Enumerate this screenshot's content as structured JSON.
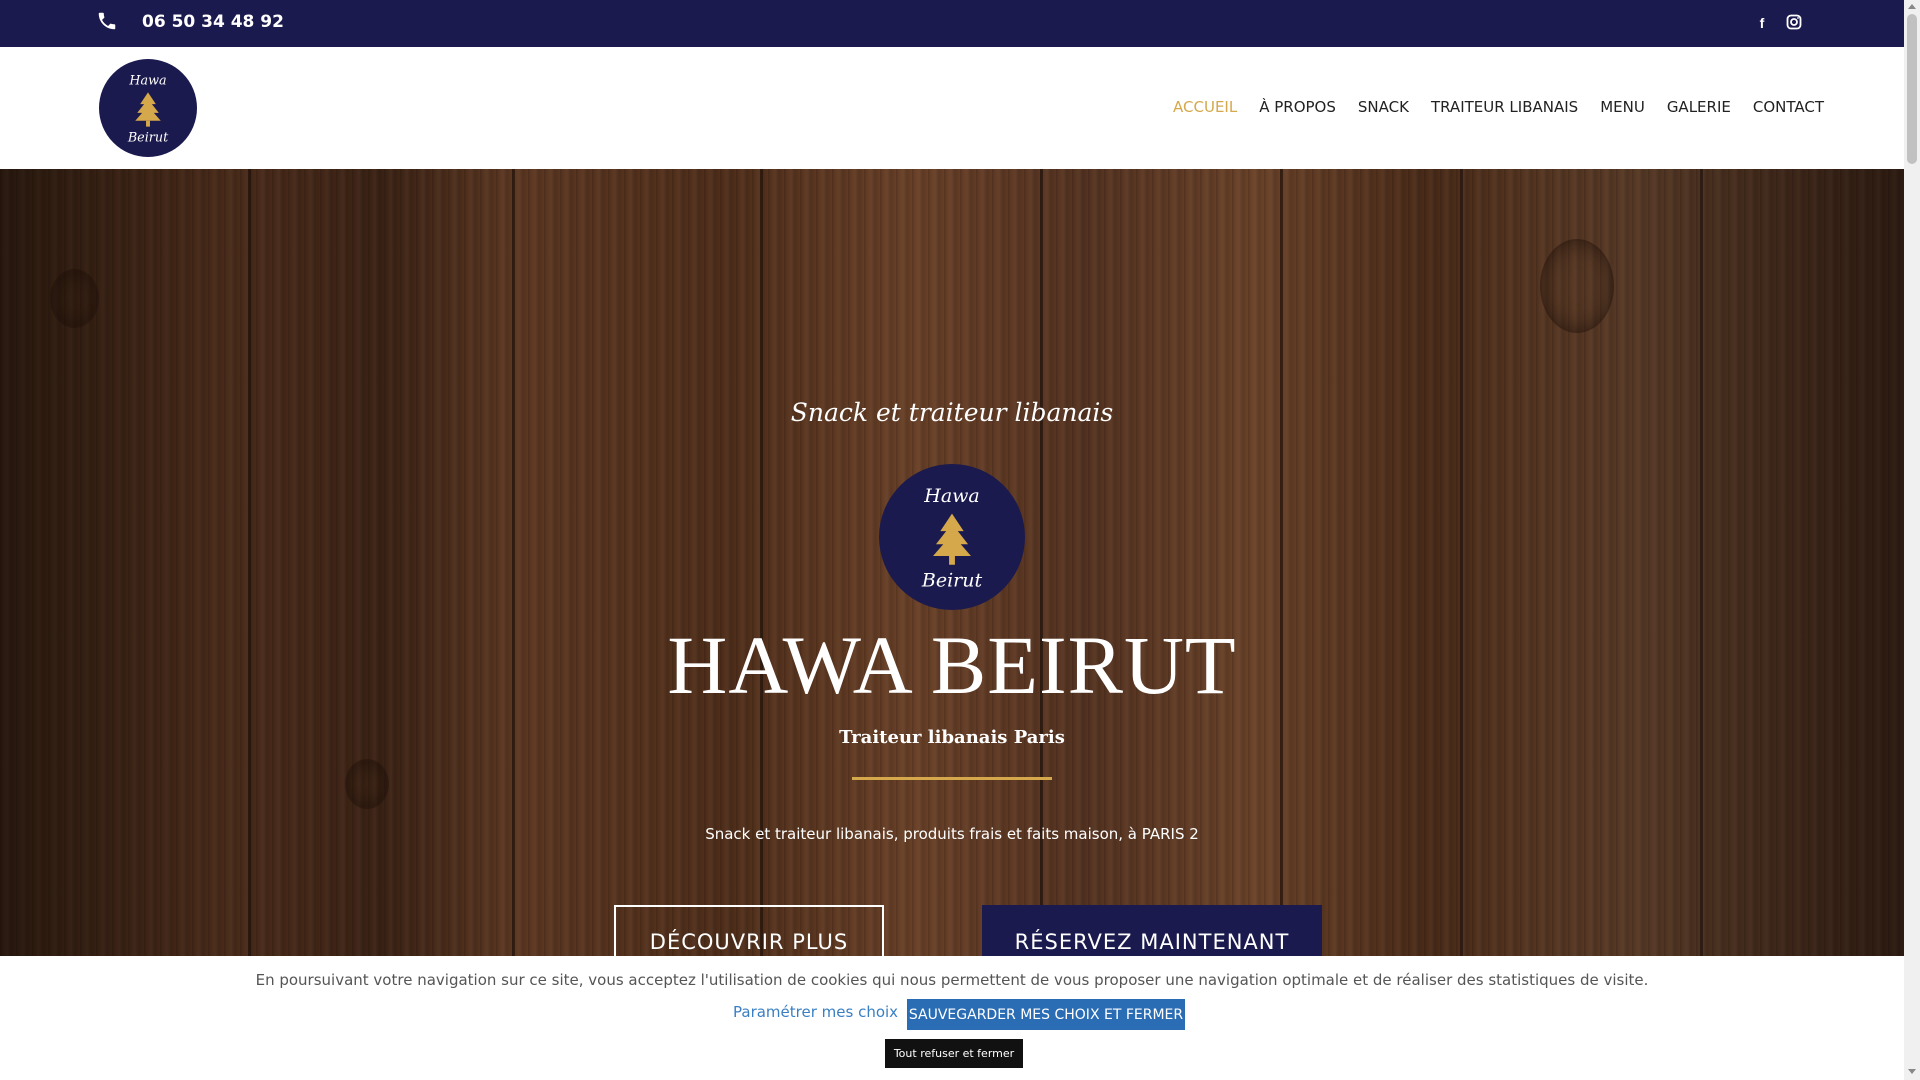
{
  "topbar": {
    "phone": "06 50 34 48 92",
    "social": [
      "facebook-icon",
      "instagram-icon"
    ],
    "facebook_glyph": "f"
  },
  "brand": {
    "logo_line1": "Hawa",
    "logo_line2": "Beirut",
    "colors": {
      "navy": "#1b1a4e",
      "gold": "#d4a84b"
    }
  },
  "nav": {
    "items": [
      {
        "label": "ACCUEIL",
        "active": true
      },
      {
        "label": "À PROPOS"
      },
      {
        "label": "SNACK"
      },
      {
        "label": "TRAITEUR LIBANAIS"
      },
      {
        "label": "MENU"
      },
      {
        "label": "GALERIE"
      },
      {
        "label": "CONTACT"
      }
    ]
  },
  "hero": {
    "script_line": "Snack et traiteur libanais",
    "title": "HAWA BEIRUT",
    "subtitle": "Traiteur libanais Paris",
    "description": "Snack et traiteur libanais, produits frais et faits maison, à PARIS 2",
    "btn_discover": "DÉCOUVRIR PLUS",
    "btn_reserve": "RÉSERVEZ MAINTENANT"
  },
  "cookie": {
    "text": "En poursuivant votre navigation sur ce site, vous acceptez l'utilisation de cookies qui nous permettent de vous proposer une navigation optimale et de réaliser des statistiques de visite.",
    "settings_link": "Paramétrer mes choix",
    "save_button": "SAUVEGARDER MES CHOIX ET FERMER",
    "refuse_button": "Tout refuser et fermer"
  }
}
